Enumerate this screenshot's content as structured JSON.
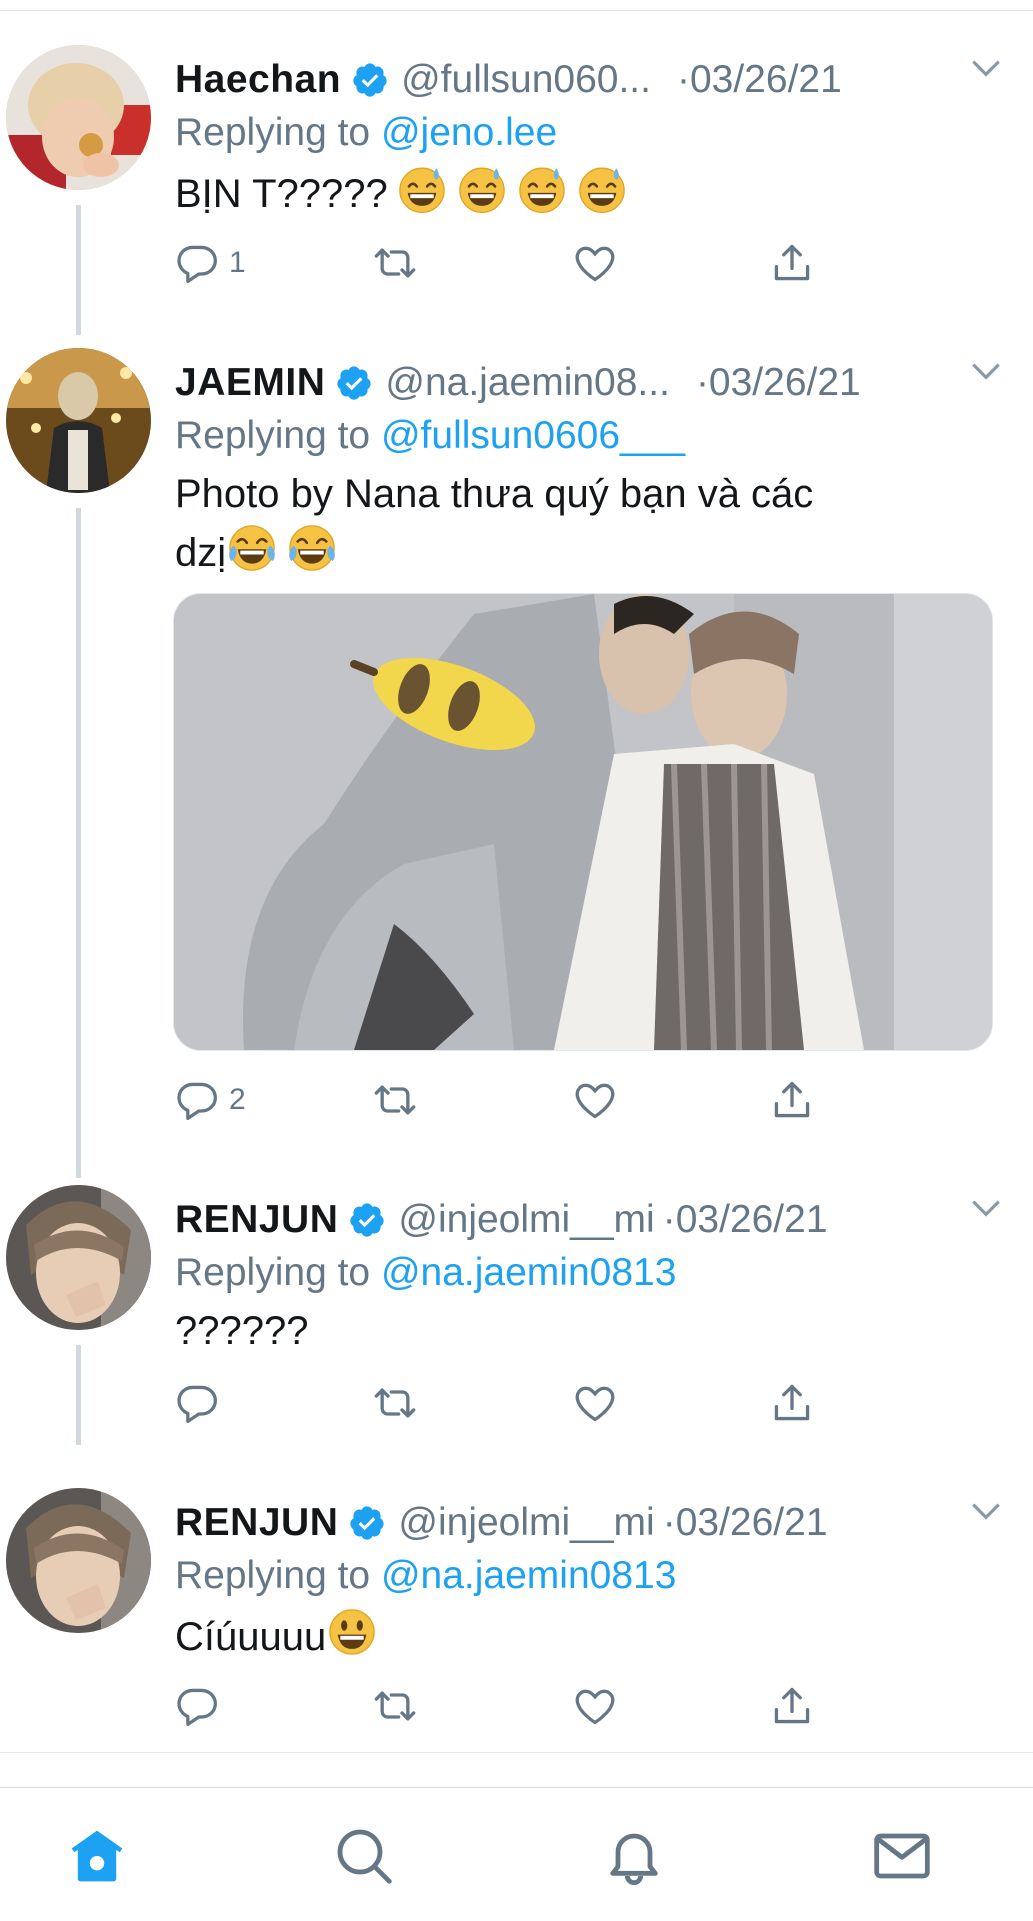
{
  "accent_color": "#1da1f2",
  "tweets": [
    {
      "name": "Haechan",
      "handle": "@fullsun060...",
      "date": "·03/26/21",
      "reply_prefix": "Replying to ",
      "reply_handle": "@jeno.lee",
      "text": "BỊN T?????",
      "emojis": [
        "sweat-smile-emoji",
        "sweat-smile-emoji",
        "sweat-smile-emoji",
        "sweat-smile-emoji"
      ],
      "reply_count": "1"
    },
    {
      "name": "JAEMIN",
      "handle": "@na.jaemin08...",
      "date": "·03/26/21",
      "reply_prefix": "Replying to ",
      "reply_handle": "@fullsun0606___",
      "text_line1": "Photo by Nana thưa quý bạn và các",
      "text_line2": "dzị",
      "emojis": [
        "tears-of-joy-emoji",
        "tears-of-joy-emoji"
      ],
      "reply_count": "2"
    },
    {
      "name": "RENJUN",
      "handle": "@injeolmi__mi",
      "date": "·03/26/21",
      "reply_prefix": "Replying to ",
      "reply_handle": "@na.jaemin0813",
      "text": "??????",
      "reply_count": ""
    },
    {
      "name": "RENJUN",
      "handle": "@injeolmi__mi",
      "date": "·03/26/21",
      "reply_prefix": "Replying to ",
      "reply_handle": "@na.jaemin0813",
      "text": "Cíúuuuu",
      "emojis": [
        "grinning-emoji"
      ],
      "reply_count": ""
    }
  ],
  "tabbar": [
    "home-icon",
    "search-icon",
    "notifications-icon",
    "messages-icon"
  ]
}
